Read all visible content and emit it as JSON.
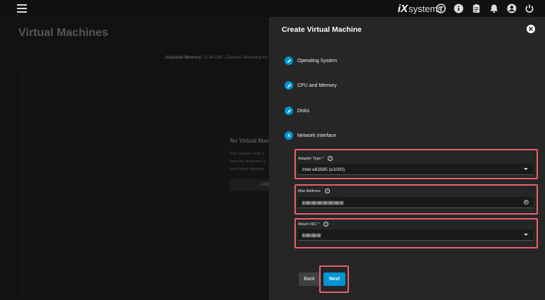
{
  "topbar": {
    "logo_mark": "iX",
    "logo_text": "systems"
  },
  "background": {
    "page_title": "Virtual Machines",
    "available_memory_label": "Available Memory:",
    "available_memory_value": "11.94 GiB - Caution: Allocating mo",
    "empty_title": "No Virtual Machi",
    "empty_desc": "The system could n from the database. L and Virtual Machine",
    "empty_add": "Add"
  },
  "panel": {
    "title": "Create Virtual Machine",
    "steps": [
      {
        "label": "Operating System",
        "state": "done"
      },
      {
        "label": "CPU and Memory",
        "state": "done"
      },
      {
        "label": "Disks",
        "state": "done"
      },
      {
        "label": "Network Interface",
        "state": "active",
        "number": "4"
      }
    ],
    "fields": {
      "adapter_type": {
        "label": "Adapter Type *",
        "value": "Intel e82585 (e1000)"
      },
      "mac_address": {
        "label": "Mac Address"
      },
      "attach_nic": {
        "label": "Attach NIC *"
      }
    },
    "back_label": "Back",
    "next_label": "Next"
  },
  "colors": {
    "accent": "#0095d5",
    "highlight": "#e5616a",
    "panel_bg": "#262626"
  }
}
